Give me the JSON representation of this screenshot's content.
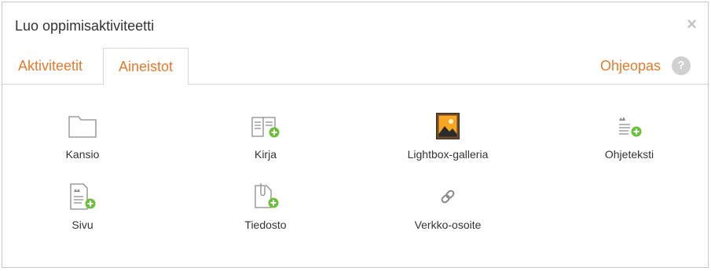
{
  "dialog": {
    "title": "Luo oppimisaktiviteetti",
    "close_glyph": "×"
  },
  "tabs": [
    {
      "label": "Aktiviteetit",
      "active": false
    },
    {
      "label": "Aineistot",
      "active": true
    }
  ],
  "help": {
    "label": "Ohjeopas",
    "icon_glyph": "?"
  },
  "items": [
    {
      "label": "Kansio",
      "icon": "folder-icon"
    },
    {
      "label": "Kirja",
      "icon": "book-add-icon"
    },
    {
      "label": "Lightbox-galleria",
      "icon": "image-gallery-icon"
    },
    {
      "label": "Ohjeteksti",
      "icon": "text-media-add-icon"
    },
    {
      "label": "Sivu",
      "icon": "page-add-icon"
    },
    {
      "label": "Tiedosto",
      "icon": "file-add-icon"
    },
    {
      "label": "Verkko-osoite",
      "icon": "link-icon"
    }
  ],
  "colors": {
    "accent": "#e57a2b",
    "add_badge": "#6bbf3b",
    "icon_gray": "#8a8a8a"
  }
}
